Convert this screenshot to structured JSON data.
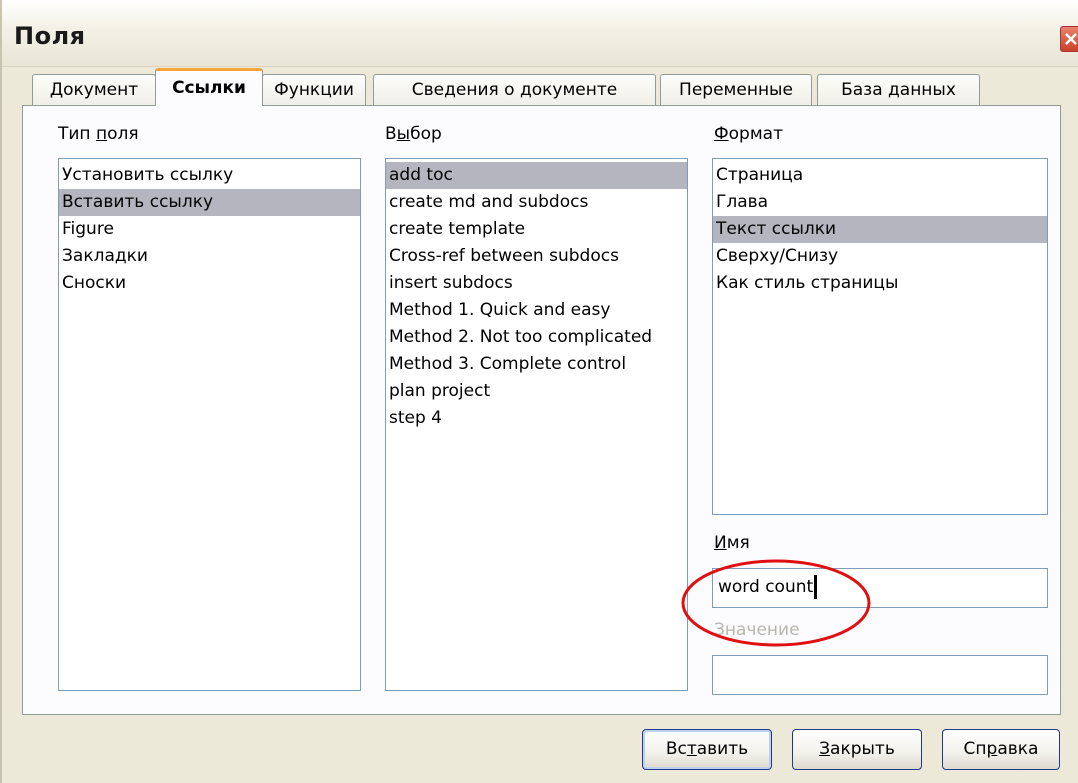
{
  "window": {
    "title": "Поля"
  },
  "tabs": [
    "Документ",
    "Ссылки",
    "Функции",
    "Сведения о документе",
    "Переменные",
    "База данных"
  ],
  "active_tab": "Ссылки",
  "field_type": {
    "label": "Тип поля",
    "items": [
      "Установить ссылку",
      "Вставить ссылку",
      "Figure",
      "Закладки",
      "Сноски"
    ],
    "selected": "Вставить ссылку"
  },
  "selection": {
    "label": "Выбор",
    "items": [
      "add toc",
      "create md and subdocs",
      "create template",
      "Cross-ref between subdocs",
      "insert subdocs",
      "Method 1. Quick and easy",
      "Method 2. Not too complicated",
      "Method 3. Complete control",
      "plan project",
      "step 4"
    ],
    "selected": "add toc"
  },
  "format": {
    "label": "Формат",
    "items": [
      "Страница",
      "Глава",
      "Текст ссылки",
      "Сверху/Снизу",
      "Как стиль страницы"
    ],
    "selected": "Текст ссылки"
  },
  "name": {
    "label": "Имя",
    "value": "word count"
  },
  "value_field": {
    "label": "Значение",
    "value": ""
  },
  "buttons": {
    "insert": "Вставить",
    "close": "Закрыть",
    "help": "Справка"
  },
  "colors": {
    "dialog_bg": "#ece9d8",
    "selection": "#b5b5bf",
    "tab_accent": "#f9a53d",
    "annotation": "#e01010"
  }
}
